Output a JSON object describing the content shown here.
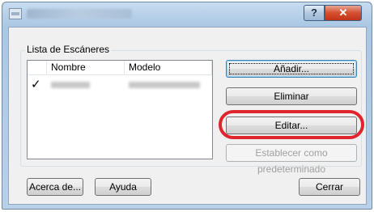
{
  "window": {
    "title_obscured": true,
    "help_label": "?",
    "close_label": "✕"
  },
  "group": {
    "label": "Lista de Escáneres"
  },
  "list": {
    "columns": [
      "",
      "Nombre",
      "Modelo"
    ],
    "rows": [
      {
        "checked": "✓"
      }
    ]
  },
  "buttons": {
    "add": "Añadir...",
    "delete": "Eliminar",
    "edit": "Editar...",
    "set_default": "Establecer como predeterminado",
    "about": "Acerca de...",
    "help": "Ayuda",
    "close": "Cerrar"
  },
  "colors": {
    "highlight": "#e0252f",
    "titlebar": "#aac7e3"
  }
}
